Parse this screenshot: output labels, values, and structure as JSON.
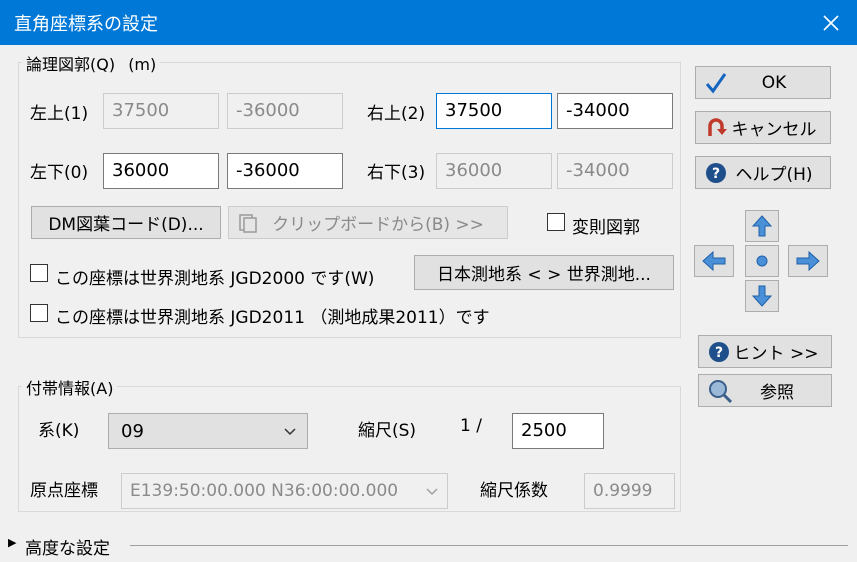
{
  "window": {
    "title": "直角座標系の設定",
    "close_glyph": "✕"
  },
  "logical_frame": {
    "legend": "論理図郭(Q)",
    "unit": "(m)",
    "top_left": {
      "label": "左上(1)",
      "x": "37500",
      "y": "-36000"
    },
    "top_right": {
      "label": "右上(2)",
      "x": "37500",
      "y": "-34000"
    },
    "bottom_left": {
      "label": "左下(0)",
      "x": "36000",
      "y": "-36000"
    },
    "bottom_right": {
      "label": "右下(3)",
      "x": "36000",
      "y": "-34000"
    },
    "dm_button": "DM図葉コード(D)...",
    "clipboard_button": "クリップボードから(B) >>",
    "irregular_label": "変則図郭",
    "jgd2000_label": "この座標は世界測地系 JGD2000 です(W)",
    "convert_button": "日本測地系 <   > 世界測地...",
    "jgd2011_label": "この座標は世界測地系 JGD2011 （測地成果2011）です"
  },
  "side_buttons": {
    "ok": "OK",
    "cancel": "キャンセル",
    "help": "ヘルプ(H)",
    "hint": "ヒント >>",
    "ref": "参照"
  },
  "extra_info": {
    "legend": "付帯情報(A)",
    "system_label": "系(K)",
    "system_value": "09",
    "scale_label": "縮尺(S)",
    "scale_prefix": "1 /",
    "scale_value": "2500",
    "origin_label": "原点座標",
    "origin_value": "E139:50:00.000 N36:00:00.000",
    "factor_label": "縮尺係数",
    "factor_value": "0.9999"
  },
  "advanced": {
    "label": "高度な設定"
  },
  "colors": {
    "titlebar": "#0078d7",
    "focus_border": "#0078d7",
    "arrow_fill": "#4a90d9",
    "cancel_icon": "#c0392b"
  }
}
